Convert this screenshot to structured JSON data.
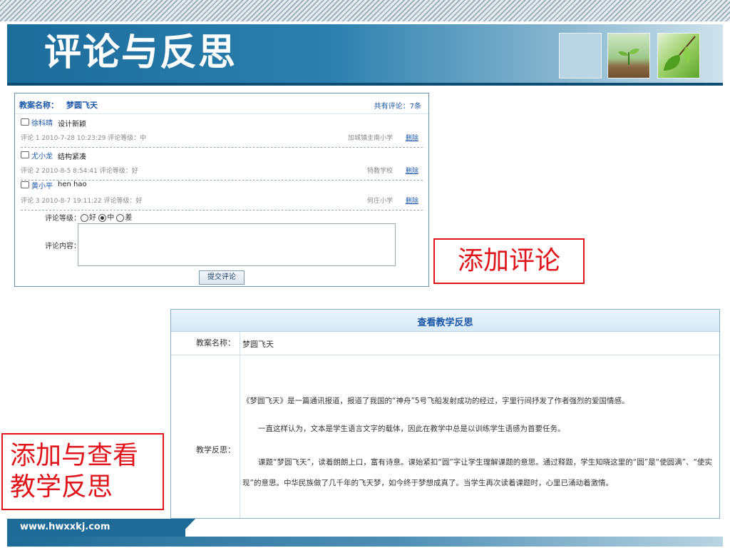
{
  "slide": {
    "title": "评论与反思",
    "footer_url": "www.hwxxkj.com"
  },
  "comments": {
    "lesson_label": "教案名称：",
    "lesson_name": "梦圆飞天",
    "total": "共有评论：7条",
    "items": [
      {
        "user": "徐科晴",
        "text": "设计新颖",
        "meta": "评论 1   2010-7-28 10:23:29   评论等级：中",
        "school": "加城镇圭南小学",
        "delete": "删除"
      },
      {
        "user": "尤小龙",
        "text": "结构紧凑",
        "meta": "评论 2   2010-8-5 8:54:41   评论等级：好",
        "school": "特教学校",
        "delete": "删除"
      },
      {
        "user": "黄小平",
        "text": "hen hao",
        "meta": "评论 3   2010-8-7 19:11:22   评论等级：好",
        "school": "何庄小学",
        "delete": "删除"
      }
    ],
    "grade_label": "评论等级：",
    "grade_options": [
      "好",
      "中",
      "差"
    ],
    "grade_selected": "中",
    "content_label": "评论内容：",
    "submit": "提交评论"
  },
  "callouts": {
    "add_comment": "添加评论",
    "add_view_line1": "添加与查看",
    "add_view_line2": "教学反思"
  },
  "reflection": {
    "title": "查看教学反思",
    "name_label": "教案名称：",
    "name_value": "梦圆飞天",
    "reflection_label": "教学反思：",
    "p1": "《梦圆飞天》是一篇通讯报道，报道了我国的“神舟”5号飞船发射成功的经过，字里行间抒发了作者强烈的爱国情感。",
    "p2": "一直这样认为，文本是学生语言文字的载体，因此在教学中总是以训练学生语感为首要任务。",
    "p3": "课题“梦圆飞天”，读着朗朗上口，富有诗意。课始紧扣“圆”字让学生理解课题的意思。通过释题，学生知晓这里的“圆”是“使圆满”、“使实现”的意思。中华民族做了几千年的飞天梦，如今终于梦想成真了。当学生再次读着课题时，心里已涌动着激情。"
  },
  "colors": {
    "accent_red": "#e0151b",
    "link_blue": "#1a56a8",
    "title_blue": "#1d6d9b"
  }
}
